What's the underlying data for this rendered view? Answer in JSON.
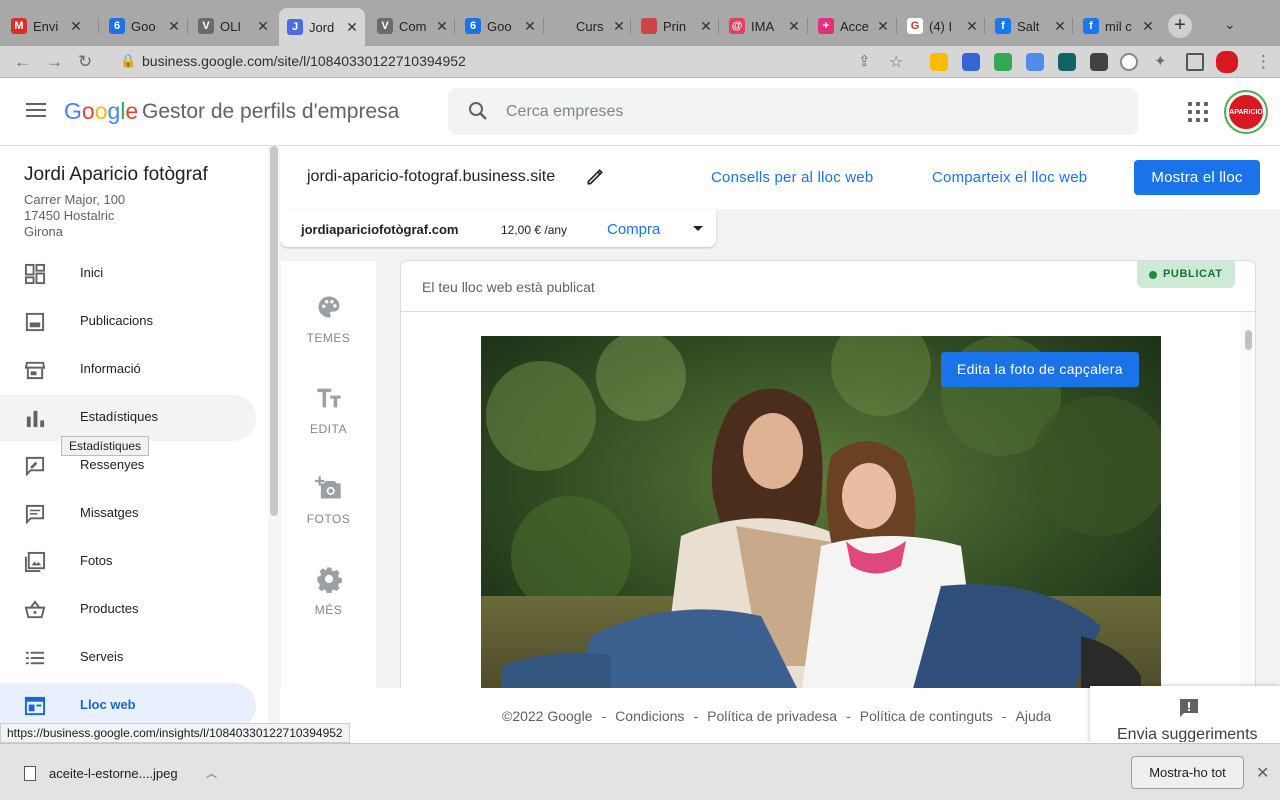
{
  "browser": {
    "tabs": [
      {
        "label": "Envi",
        "fav": "M",
        "color": "#d93025"
      },
      {
        "label": "Goo",
        "fav": "6",
        "color": "#1a73e8"
      },
      {
        "label": "OLI",
        "fav": "V",
        "color": "#6b6b6b"
      },
      {
        "label": "Jord",
        "fav": "J",
        "color": "#4a6ee0"
      },
      {
        "label": "Com",
        "fav": "V",
        "color": "#6b6b6b"
      },
      {
        "label": "Goo",
        "fav": "6",
        "color": "#1a73e8"
      },
      {
        "label": "Curs",
        "fav": "",
        "color": "#a8a8a8"
      },
      {
        "label": "Prin",
        "fav": "",
        "color": "#c44"
      },
      {
        "label": "IMA",
        "fav": "@",
        "color": "#e2425d"
      },
      {
        "label": "Acce",
        "fav": "+",
        "color": "#e0317e"
      },
      {
        "label": "(4) I",
        "fav": "G",
        "color": "#ffffff"
      },
      {
        "label": "Salt",
        "fav": "f",
        "color": "#1877f2"
      },
      {
        "label": "mil c",
        "fav": "f",
        "color": "#1877f2"
      }
    ],
    "url": "business.google.com/site/l/10840330122710394952",
    "status_url": "https://business.google.com/insights/l/10840330122710394952"
  },
  "header": {
    "logo": [
      "G",
      "o",
      "o",
      "g",
      "l",
      "e"
    ],
    "product_name": "Gestor de perfils d'empresa",
    "search_placeholder": "Cerca empreses",
    "avatar_text": "APARICIO"
  },
  "sidebar": {
    "business_name": "Jordi Aparicio fotògraf",
    "address": [
      "Carrer Major, 100",
      "17450 Hostalric",
      "Girona"
    ],
    "items": [
      {
        "label": "Inici",
        "icon": "dashboard-icon"
      },
      {
        "label": "Publicacions",
        "icon": "posts-icon"
      },
      {
        "label": "Informació",
        "icon": "storefront-icon"
      },
      {
        "label": "Estadístiques",
        "icon": "bar-chart-icon"
      },
      {
        "label": "Ressenyes",
        "icon": "reviews-icon"
      },
      {
        "label": "Missatges",
        "icon": "messages-icon"
      },
      {
        "label": "Fotos",
        "icon": "photos-icon"
      },
      {
        "label": "Productes",
        "icon": "basket-icon"
      },
      {
        "label": "Serveis",
        "icon": "list-icon"
      },
      {
        "label": "Lloc web",
        "icon": "website-icon"
      }
    ],
    "tooltip": "Estadístiques"
  },
  "site": {
    "address": "jordi-aparicio-fotograf.business.site",
    "tips_link": "Consells per al lloc web",
    "share_link": "Comparteix el lloc web",
    "show_button": "Mostra el lloc",
    "domain": "jordiapariciofotògraf.com",
    "price": "12,00 € /any",
    "buy": "Compra"
  },
  "tools": [
    {
      "label": "TEMES",
      "icon": "palette-icon"
    },
    {
      "label": "EDITA",
      "icon": "text-format-icon"
    },
    {
      "label": "FOTOS",
      "icon": "add-photo-icon"
    },
    {
      "label": "MÉS",
      "icon": "settings-gear-icon"
    }
  ],
  "preview": {
    "status_text": "El teu lloc web està publicat",
    "badge": "PUBLICAT",
    "edit_photo": "Edita la foto de capçalera"
  },
  "footer": {
    "links": [
      "©2022 Google",
      "Condicions",
      "Política de privadesa",
      "Política de continguts",
      "Ajuda"
    ],
    "feedback": "Envia suggeriments"
  },
  "downloads": {
    "file": "aceite-l-estorne....jpeg",
    "show_all": "Mostra-ho tot"
  },
  "colors": {
    "accent": "#1a73e8",
    "published": "#1e8e3e"
  }
}
